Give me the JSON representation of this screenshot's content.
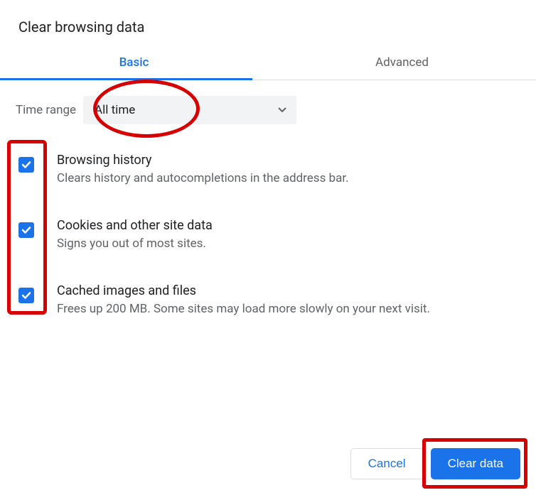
{
  "title": "Clear browsing data",
  "tabs": {
    "basic": "Basic",
    "advanced": "Advanced"
  },
  "time": {
    "label": "Time range",
    "value": "All time"
  },
  "options": [
    {
      "title": "Browsing history",
      "desc": "Clears history and autocompletions in the address bar."
    },
    {
      "title": "Cookies and other site data",
      "desc": "Signs you out of most sites."
    },
    {
      "title": "Cached images and files",
      "desc": "Frees up 200 MB. Some sites may load more slowly on your next visit."
    }
  ],
  "buttons": {
    "cancel": "Cancel",
    "confirm": "Clear data"
  }
}
